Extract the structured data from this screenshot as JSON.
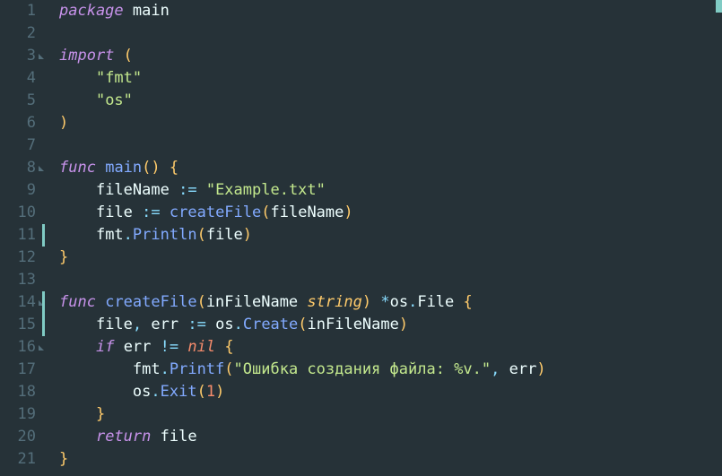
{
  "editor": {
    "language": "go",
    "lines": [
      {
        "num": 1,
        "fold": false,
        "bar": false,
        "tokens": [
          [
            "kw",
            "package"
          ],
          [
            "sp",
            " "
          ],
          [
            "pkg",
            "main"
          ]
        ]
      },
      {
        "num": 2,
        "fold": false,
        "bar": false,
        "tokens": []
      },
      {
        "num": 3,
        "fold": true,
        "bar": false,
        "tokens": [
          [
            "kw",
            "import"
          ],
          [
            "sp",
            " "
          ],
          [
            "paren",
            "("
          ]
        ]
      },
      {
        "num": 4,
        "fold": false,
        "bar": false,
        "tokens": [
          [
            "sp",
            "    "
          ],
          [
            "str",
            "\"fmt\""
          ]
        ]
      },
      {
        "num": 5,
        "fold": false,
        "bar": false,
        "tokens": [
          [
            "sp",
            "    "
          ],
          [
            "str",
            "\"os\""
          ]
        ]
      },
      {
        "num": 6,
        "fold": false,
        "bar": false,
        "tokens": [
          [
            "paren",
            ")"
          ]
        ]
      },
      {
        "num": 7,
        "fold": false,
        "bar": false,
        "tokens": []
      },
      {
        "num": 8,
        "fold": true,
        "bar": false,
        "tokens": [
          [
            "kw",
            "func"
          ],
          [
            "sp",
            " "
          ],
          [
            "fn",
            "main"
          ],
          [
            "paren",
            "()"
          ],
          [
            "sp",
            " "
          ],
          [
            "brace",
            "{"
          ]
        ]
      },
      {
        "num": 9,
        "fold": false,
        "bar": false,
        "tokens": [
          [
            "sp",
            "    "
          ],
          [
            "ident",
            "fileName"
          ],
          [
            "sp",
            " "
          ],
          [
            "op",
            ":="
          ],
          [
            "sp",
            " "
          ],
          [
            "str",
            "\"Example.txt\""
          ]
        ]
      },
      {
        "num": 10,
        "fold": false,
        "bar": false,
        "tokens": [
          [
            "sp",
            "    "
          ],
          [
            "ident",
            "file"
          ],
          [
            "sp",
            " "
          ],
          [
            "op",
            ":="
          ],
          [
            "sp",
            " "
          ],
          [
            "call",
            "createFile"
          ],
          [
            "paren",
            "("
          ],
          [
            "ident",
            "fileName"
          ],
          [
            "paren",
            ")"
          ]
        ]
      },
      {
        "num": 11,
        "fold": false,
        "bar": true,
        "tokens": [
          [
            "sp",
            "    "
          ],
          [
            "ident",
            "fmt"
          ],
          [
            "punc",
            "."
          ],
          [
            "call",
            "Println"
          ],
          [
            "paren",
            "("
          ],
          [
            "ident",
            "file"
          ],
          [
            "paren",
            ")"
          ]
        ]
      },
      {
        "num": 12,
        "fold": false,
        "bar": false,
        "tokens": [
          [
            "brace",
            "}"
          ]
        ]
      },
      {
        "num": 13,
        "fold": false,
        "bar": false,
        "tokens": []
      },
      {
        "num": 14,
        "fold": true,
        "bar": true,
        "tokens": [
          [
            "kw",
            "func"
          ],
          [
            "sp",
            " "
          ],
          [
            "fn",
            "createFile"
          ],
          [
            "paren",
            "("
          ],
          [
            "ident",
            "inFileName"
          ],
          [
            "sp",
            " "
          ],
          [
            "type",
            "string"
          ],
          [
            "paren",
            ")"
          ],
          [
            "sp",
            " "
          ],
          [
            "star",
            "*"
          ],
          [
            "ident",
            "os"
          ],
          [
            "punc",
            "."
          ],
          [
            "ident",
            "File"
          ],
          [
            "sp",
            " "
          ],
          [
            "brace",
            "{"
          ]
        ]
      },
      {
        "num": 15,
        "fold": false,
        "bar": true,
        "tokens": [
          [
            "sp",
            "    "
          ],
          [
            "ident",
            "file"
          ],
          [
            "punc",
            ","
          ],
          [
            "sp",
            " "
          ],
          [
            "ident",
            "err"
          ],
          [
            "sp",
            " "
          ],
          [
            "op",
            ":="
          ],
          [
            "sp",
            " "
          ],
          [
            "ident",
            "os"
          ],
          [
            "punc",
            "."
          ],
          [
            "call",
            "Create"
          ],
          [
            "paren",
            "("
          ],
          [
            "ident",
            "inFileName"
          ],
          [
            "paren",
            ")"
          ]
        ]
      },
      {
        "num": 16,
        "fold": true,
        "bar": false,
        "tokens": [
          [
            "sp",
            "    "
          ],
          [
            "kw",
            "if"
          ],
          [
            "sp",
            " "
          ],
          [
            "ident",
            "err"
          ],
          [
            "sp",
            " "
          ],
          [
            "op",
            "!="
          ],
          [
            "sp",
            " "
          ],
          [
            "nil",
            "nil"
          ],
          [
            "sp",
            " "
          ],
          [
            "brace",
            "{"
          ]
        ]
      },
      {
        "num": 17,
        "fold": false,
        "bar": false,
        "tokens": [
          [
            "sp",
            "        "
          ],
          [
            "ident",
            "fmt"
          ],
          [
            "punc",
            "."
          ],
          [
            "call",
            "Printf"
          ],
          [
            "paren",
            "("
          ],
          [
            "str",
            "\"Ошибка создания файла: %v.\""
          ],
          [
            "punc",
            ","
          ],
          [
            "sp",
            " "
          ],
          [
            "ident",
            "err"
          ],
          [
            "paren",
            ")"
          ]
        ]
      },
      {
        "num": 18,
        "fold": false,
        "bar": false,
        "tokens": [
          [
            "sp",
            "        "
          ],
          [
            "ident",
            "os"
          ],
          [
            "punc",
            "."
          ],
          [
            "call",
            "Exit"
          ],
          [
            "paren",
            "("
          ],
          [
            "num",
            "1"
          ],
          [
            "paren",
            ")"
          ]
        ]
      },
      {
        "num": 19,
        "fold": false,
        "bar": false,
        "tokens": [
          [
            "sp",
            "    "
          ],
          [
            "brace",
            "}"
          ]
        ]
      },
      {
        "num": 20,
        "fold": false,
        "bar": false,
        "tokens": [
          [
            "sp",
            "    "
          ],
          [
            "kw",
            "return"
          ],
          [
            "sp",
            " "
          ],
          [
            "ident",
            "file"
          ]
        ]
      },
      {
        "num": 21,
        "fold": false,
        "bar": false,
        "tokens": [
          [
            "brace",
            "}"
          ]
        ]
      }
    ]
  }
}
